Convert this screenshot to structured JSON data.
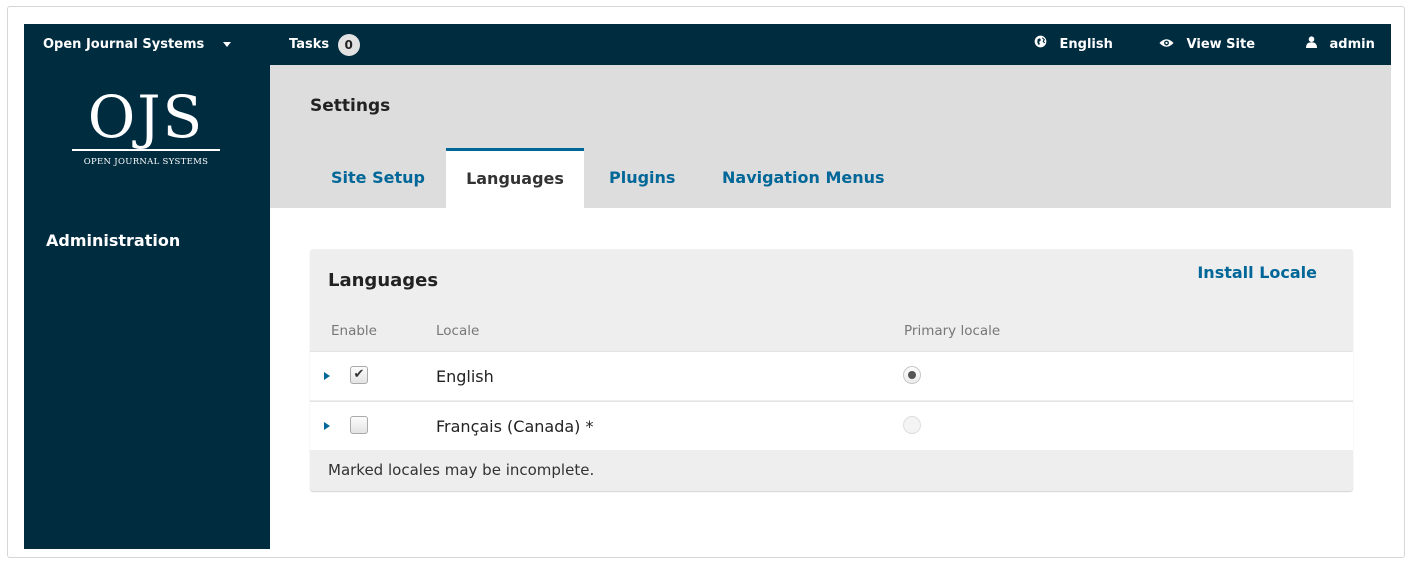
{
  "topbar": {
    "context_label": "Open Journal Systems",
    "tasks_label": "Tasks",
    "tasks_count": "0",
    "language_label": "English",
    "view_site_label": "View Site",
    "user_label": "admin"
  },
  "sidebar": {
    "logo_text": "OJS",
    "logo_subtitle": "OPEN JOURNAL SYSTEMS",
    "nav_item": "Administration"
  },
  "page": {
    "title": "Settings",
    "tabs": [
      {
        "label": "Site Setup",
        "active": false
      },
      {
        "label": "Languages",
        "active": true
      },
      {
        "label": "Plugins",
        "active": false
      },
      {
        "label": "Navigation Menus",
        "active": false
      }
    ]
  },
  "panel": {
    "title": "Languages",
    "install_link": "Install Locale",
    "columns": {
      "enable": "Enable",
      "locale": "Locale",
      "primary": "Primary locale"
    },
    "rows": [
      {
        "name": "English",
        "enabled": true,
        "primary": true
      },
      {
        "name": "Français (Canada) *",
        "enabled": false,
        "primary": false
      }
    ],
    "footnote": "Marked locales may be incomplete."
  },
  "icons": {
    "context_dropdown": "caret-down-icon",
    "language": "globe-icon",
    "view_site": "eye-icon",
    "user": "user-icon",
    "row_expand": "expand-triangle-icon",
    "checkbox_checked": "checkmark-icon"
  },
  "colors": {
    "brand_dark": "#002c40",
    "link": "#006798",
    "header_bg": "#dddddd"
  }
}
